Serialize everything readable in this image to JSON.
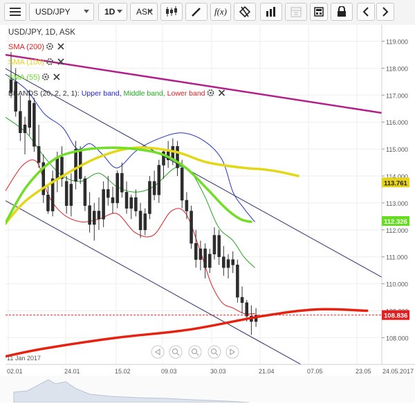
{
  "toolbar": {
    "symbol": "USD/JPY",
    "timeframe": "1D",
    "price_type": "ASK",
    "function_label": "f(x)"
  },
  "chart_header": "USD/JPY, 1D, ASK",
  "indicators": [
    {
      "name": "SMA (200)",
      "color": "#e02020"
    },
    {
      "name": "SMA (100)",
      "color": "#e6d21a"
    },
    {
      "name": "SMA (55)",
      "color": "#66dd22"
    }
  ],
  "bbands": {
    "prefix": "BBANDS (20, 2, 2, 1):",
    "upper": "Upper band,",
    "middle": "Middle band,",
    "lower": "Lower band",
    "upper_color": "#2222cc",
    "middle_color": "#22aa22",
    "lower_color": "#dd2222"
  },
  "start_date_label": "11 Jan 2017",
  "chart_data": {
    "type": "line",
    "ylim": [
      107.6,
      119.3
    ],
    "y_ticks": [
      "119.000",
      "118.000",
      "117.000",
      "116.000",
      "115.000",
      "114.000",
      "113.000",
      "112.000",
      "111.000",
      "110.000",
      "109.000",
      "108.000"
    ],
    "x_ticks": [
      "02.01",
      "24.01",
      "15.02",
      "09.03",
      "30.03",
      "21.04",
      "07.05",
      "23.05",
      "24.05.2017"
    ],
    "price_tags": [
      {
        "label": "113.761",
        "value": 113.76,
        "color": "#e6d21a"
      },
      {
        "label": "112.326",
        "value": 112.33,
        "color": "#66dd22"
      },
      {
        "label": "108.836",
        "value": 108.84,
        "color": "#e02020"
      }
    ],
    "current_price": 108.84,
    "candles": [
      {
        "o": 117.1,
        "h": 118.6,
        "l": 116.9,
        "c": 117.6
      },
      {
        "o": 117.5,
        "h": 118.0,
        "l": 116.2,
        "c": 116.4
      },
      {
        "o": 116.4,
        "h": 117.0,
        "l": 115.3,
        "c": 115.6
      },
      {
        "o": 115.6,
        "h": 116.2,
        "l": 114.8,
        "c": 115.9
      },
      {
        "o": 115.8,
        "h": 117.2,
        "l": 115.5,
        "c": 116.8
      },
      {
        "o": 116.7,
        "h": 116.9,
        "l": 114.9,
        "c": 115.1
      },
      {
        "o": 115.1,
        "h": 115.9,
        "l": 114.3,
        "c": 114.5
      },
      {
        "o": 114.5,
        "h": 114.8,
        "l": 113.0,
        "c": 113.3
      },
      {
        "o": 113.3,
        "h": 113.7,
        "l": 112.6,
        "c": 112.7
      },
      {
        "o": 112.7,
        "h": 114.2,
        "l": 112.5,
        "c": 113.9
      },
      {
        "o": 113.9,
        "h": 114.9,
        "l": 113.4,
        "c": 114.7
      },
      {
        "o": 114.7,
        "h": 115.1,
        "l": 113.6,
        "c": 113.9
      },
      {
        "o": 113.8,
        "h": 114.0,
        "l": 112.6,
        "c": 112.9
      },
      {
        "o": 112.9,
        "h": 114.1,
        "l": 112.5,
        "c": 113.7
      },
      {
        "o": 113.8,
        "h": 115.3,
        "l": 113.5,
        "c": 115.0
      },
      {
        "o": 115.0,
        "h": 115.1,
        "l": 113.7,
        "c": 113.9
      },
      {
        "o": 113.9,
        "h": 114.0,
        "l": 112.7,
        "c": 112.9
      },
      {
        "o": 112.9,
        "h": 113.4,
        "l": 111.9,
        "c": 112.2
      },
      {
        "o": 112.2,
        "h": 113.0,
        "l": 111.6,
        "c": 112.7
      },
      {
        "o": 112.7,
        "h": 113.2,
        "l": 112.0,
        "c": 112.4
      },
      {
        "o": 112.4,
        "h": 113.8,
        "l": 112.1,
        "c": 113.5
      },
      {
        "o": 113.5,
        "h": 114.0,
        "l": 112.9,
        "c": 113.2
      },
      {
        "o": 113.2,
        "h": 113.6,
        "l": 112.6,
        "c": 113.0
      },
      {
        "o": 113.0,
        "h": 114.2,
        "l": 112.8,
        "c": 114.1
      },
      {
        "o": 114.1,
        "h": 114.5,
        "l": 113.2,
        "c": 113.4
      },
      {
        "o": 113.4,
        "h": 113.8,
        "l": 112.6,
        "c": 112.8
      },
      {
        "o": 112.8,
        "h": 113.3,
        "l": 112.4,
        "c": 113.2
      },
      {
        "o": 113.2,
        "h": 113.5,
        "l": 112.5,
        "c": 112.7
      },
      {
        "o": 112.7,
        "h": 113.0,
        "l": 111.7,
        "c": 112.0
      },
      {
        "o": 112.0,
        "h": 112.8,
        "l": 111.8,
        "c": 112.6
      },
      {
        "o": 112.6,
        "h": 114.0,
        "l": 112.4,
        "c": 113.8
      },
      {
        "o": 113.8,
        "h": 114.2,
        "l": 113.1,
        "c": 113.3
      },
      {
        "o": 113.3,
        "h": 114.6,
        "l": 113.0,
        "c": 114.4
      },
      {
        "o": 114.4,
        "h": 115.0,
        "l": 113.9,
        "c": 114.9
      },
      {
        "o": 114.9,
        "h": 115.3,
        "l": 114.3,
        "c": 114.6
      },
      {
        "o": 114.6,
        "h": 115.4,
        "l": 114.4,
        "c": 115.1
      },
      {
        "o": 115.1,
        "h": 115.3,
        "l": 114.0,
        "c": 114.3
      },
      {
        "o": 114.3,
        "h": 114.6,
        "l": 112.8,
        "c": 113.1
      },
      {
        "o": 113.1,
        "h": 113.4,
        "l": 112.4,
        "c": 112.7
      },
      {
        "o": 112.7,
        "h": 112.9,
        "l": 111.3,
        "c": 111.5
      },
      {
        "o": 111.5,
        "h": 112.0,
        "l": 110.6,
        "c": 110.9
      },
      {
        "o": 110.9,
        "h": 111.6,
        "l": 110.5,
        "c": 111.3
      },
      {
        "o": 111.3,
        "h": 111.5,
        "l": 110.2,
        "c": 110.6
      },
      {
        "o": 110.6,
        "h": 111.3,
        "l": 110.4,
        "c": 111.1
      },
      {
        "o": 111.1,
        "h": 112.1,
        "l": 110.9,
        "c": 111.8
      },
      {
        "o": 111.8,
        "h": 112.0,
        "l": 110.7,
        "c": 111.0
      },
      {
        "o": 111.0,
        "h": 111.4,
        "l": 110.3,
        "c": 110.6
      },
      {
        "o": 110.6,
        "h": 111.1,
        "l": 110.2,
        "c": 110.9
      },
      {
        "o": 110.9,
        "h": 111.2,
        "l": 110.4,
        "c": 110.7
      },
      {
        "o": 110.7,
        "h": 110.9,
        "l": 109.3,
        "c": 109.5
      },
      {
        "o": 109.5,
        "h": 109.9,
        "l": 108.9,
        "c": 109.3
      },
      {
        "o": 109.3,
        "h": 109.4,
        "l": 108.6,
        "c": 108.8
      },
      {
        "o": 108.8,
        "h": 109.2,
        "l": 108.1,
        "c": 108.6
      },
      {
        "o": 108.6,
        "h": 109.1,
        "l": 108.4,
        "c": 108.84
      }
    ],
    "sma200": [
      [
        -2,
        107.3
      ],
      [
        20,
        107.6
      ],
      [
        60,
        108.0
      ],
      [
        100,
        108.3
      ],
      [
        140,
        108.8
      ],
      [
        170,
        109.05
      ],
      [
        198,
        109.0
      ]
    ],
    "sma100": [
      [
        -2,
        112.2
      ],
      [
        10,
        113.1
      ],
      [
        30,
        114.0
      ],
      [
        50,
        114.7
      ],
      [
        70,
        115.05
      ],
      [
        92,
        114.9
      ],
      [
        110,
        114.5
      ],
      [
        130,
        114.3
      ],
      [
        140,
        114.25
      ],
      [
        150,
        114.15
      ],
      [
        160,
        114.0
      ]
    ],
    "sma55": [
      [
        -2,
        112.2
      ],
      [
        10,
        113.6
      ],
      [
        25,
        114.6
      ],
      [
        40,
        114.95
      ],
      [
        55,
        115.05
      ],
      [
        70,
        115.0
      ],
      [
        85,
        114.8
      ],
      [
        98,
        114.3
      ],
      [
        110,
        113.5
      ],
      [
        120,
        112.8
      ],
      [
        128,
        112.4
      ],
      [
        134,
        112.3
      ]
    ],
    "bb_upper": [
      [
        -2,
        117.8
      ],
      [
        10,
        117.2
      ],
      [
        20,
        116.3
      ],
      [
        30,
        115.8
      ],
      [
        38,
        115.0
      ],
      [
        45,
        115.2
      ],
      [
        52,
        114.8
      ],
      [
        60,
        114.3
      ],
      [
        70,
        114.9
      ],
      [
        80,
        115.3
      ],
      [
        95,
        115.6
      ],
      [
        108,
        115.3
      ],
      [
        118,
        114.6
      ],
      [
        124,
        113.4
      ],
      [
        130,
        112.8
      ],
      [
        136,
        112.3
      ]
    ],
    "bb_middle": [
      [
        -2,
        116.2
      ],
      [
        10,
        115.6
      ],
      [
        20,
        114.7
      ],
      [
        30,
        114.0
      ],
      [
        40,
        113.8
      ],
      [
        50,
        114.1
      ],
      [
        60,
        113.6
      ],
      [
        70,
        113.4
      ],
      [
        80,
        113.6
      ],
      [
        92,
        114.3
      ],
      [
        100,
        114.2
      ],
      [
        108,
        113.3
      ],
      [
        116,
        112.1
      ],
      [
        124,
        111.6
      ],
      [
        130,
        111.0
      ],
      [
        136,
        110.6
      ]
    ],
    "bb_lower": [
      [
        -2,
        113.4
      ],
      [
        8,
        114.4
      ],
      [
        16,
        114.5
      ],
      [
        22,
        113.3
      ],
      [
        30,
        112.6
      ],
      [
        40,
        112.3
      ],
      [
        50,
        112.4
      ],
      [
        60,
        112.6
      ],
      [
        70,
        111.9
      ],
      [
        80,
        111.8
      ],
      [
        90,
        112.7
      ],
      [
        98,
        112.6
      ],
      [
        106,
        111.2
      ],
      [
        112,
        110.0
      ],
      [
        118,
        109.3
      ],
      [
        124,
        109.1
      ],
      [
        130,
        108.9
      ],
      [
        136,
        108.9
      ]
    ],
    "trend_lines": [
      {
        "name": "purple",
        "color": "#b31f8a",
        "points": [
          [
            -2,
            118.5
          ],
          [
            210,
            116.3
          ]
        ]
      },
      {
        "name": "upper-channel",
        "color": "#2a2f6e",
        "points": [
          [
            -2,
            118.0
          ],
          [
            210,
            110.1
          ]
        ]
      },
      {
        "name": "lower-channel",
        "color": "#2a2f6e",
        "points": [
          [
            -2,
            113.1
          ],
          [
            210,
            105.2
          ]
        ]
      }
    ],
    "price_series": [
      {
        "name": "SMA (200)",
        "key": "sma200",
        "color": "#e8200f",
        "width": 3.5
      },
      {
        "name": "SMA (100)",
        "key": "sma100",
        "color": "#e3d818",
        "width": 3.5
      },
      {
        "name": "SMA (55)",
        "key": "sma55",
        "color": "#72de25",
        "width": 3.5
      },
      {
        "name": "Upper band",
        "key": "bb_upper",
        "color": "#2233cc",
        "width": 1
      },
      {
        "name": "Middle band",
        "key": "bb_middle",
        "color": "#1fa81f",
        "width": 1
      },
      {
        "name": "Lower band",
        "key": "bb_lower",
        "color": "#dd2020",
        "width": 1
      }
    ]
  },
  "nav_controls": [
    "◁",
    "⊖",
    "⊕",
    "⊖",
    "⊕",
    "▷"
  ]
}
